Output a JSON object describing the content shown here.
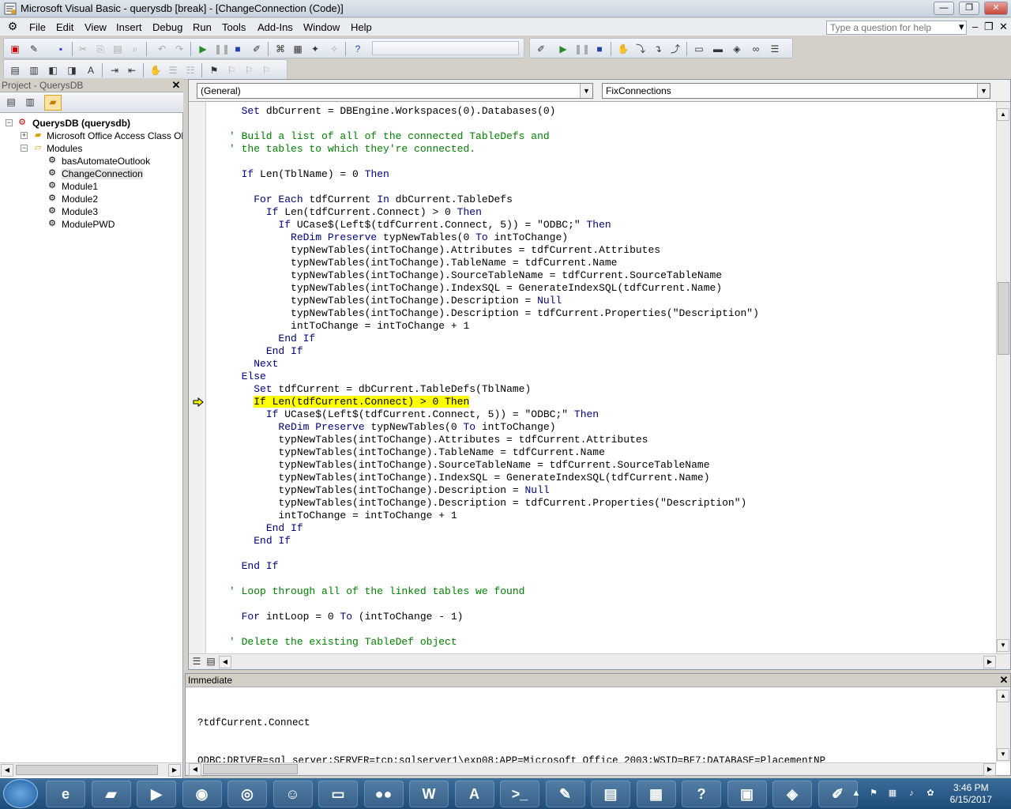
{
  "window": {
    "title": "Microsoft Visual Basic - querysdb [break] - [ChangeConnection (Code)]",
    "help_placeholder": "Type a question for help"
  },
  "menu": [
    "File",
    "Edit",
    "View",
    "Insert",
    "Debug",
    "Run",
    "Tools",
    "Add-Ins",
    "Window",
    "Help"
  ],
  "project": {
    "title": "Project - QuerysDB",
    "root": "QuerysDB (querysdb)",
    "folders": [
      "Microsoft Office Access Class Objects",
      "Modules"
    ],
    "modules": [
      "basAutomateOutlook",
      "ChangeConnection",
      "Module1",
      "Module2",
      "Module3",
      "ModulePWD"
    ],
    "selected_module": "ChangeConnection"
  },
  "code_window": {
    "object_combo": "(General)",
    "procedure_combo": "FixConnections",
    "current_line": 23,
    "lines": [
      [
        [
          "",
          "  "
        ],
        [
          "kw",
          "Set"
        ],
        [
          "",
          " dbCurrent = DBEngine.Workspaces(0).Databases(0)"
        ]
      ],
      [],
      [
        [
          "cm",
          "' Build a list of all of the connected TableDefs and"
        ]
      ],
      [
        [
          "cm",
          "' the tables to which they're connected."
        ]
      ],
      [],
      [
        [
          "",
          "  "
        ],
        [
          "kw",
          "If"
        ],
        [
          "",
          " Len(TblName) = 0 "
        ],
        [
          "kw",
          "Then"
        ]
      ],
      [],
      [
        [
          "",
          "    "
        ],
        [
          "kw",
          "For Each"
        ],
        [
          "",
          " tdfCurrent "
        ],
        [
          "kw",
          "In"
        ],
        [
          "",
          " dbCurrent.TableDefs"
        ]
      ],
      [
        [
          "",
          "      "
        ],
        [
          "kw",
          "If"
        ],
        [
          "",
          " Len(tdfCurrent.Connect) > 0 "
        ],
        [
          "kw",
          "Then"
        ]
      ],
      [
        [
          "",
          "        "
        ],
        [
          "kw",
          "If"
        ],
        [
          "",
          " UCase$(Left$(tdfCurrent.Connect, 5)) = \"ODBC;\" "
        ],
        [
          "kw",
          "Then"
        ]
      ],
      [
        [
          "",
          "          "
        ],
        [
          "kw",
          "ReDim Preserve"
        ],
        [
          "",
          " typNewTables(0 "
        ],
        [
          "kw",
          "To"
        ],
        [
          "",
          " intToChange)"
        ]
      ],
      [
        [
          "",
          "          typNewTables(intToChange).Attributes = tdfCurrent.Attributes"
        ]
      ],
      [
        [
          "",
          "          typNewTables(intToChange).TableName = tdfCurrent.Name"
        ]
      ],
      [
        [
          "",
          "          typNewTables(intToChange).SourceTableName = tdfCurrent.SourceTableName"
        ]
      ],
      [
        [
          "",
          "          typNewTables(intToChange).IndexSQL = GenerateIndexSQL(tdfCurrent.Name)"
        ]
      ],
      [
        [
          "",
          "          typNewTables(intToChange).Description = "
        ],
        [
          "kw",
          "Null"
        ]
      ],
      [
        [
          "",
          "          typNewTables(intToChange).Description = tdfCurrent.Properties(\"Description\")"
        ]
      ],
      [
        [
          "",
          "          intToChange = intToChange + 1"
        ]
      ],
      [
        [
          "",
          "        "
        ],
        [
          "kw",
          "End If"
        ]
      ],
      [
        [
          "",
          "      "
        ],
        [
          "kw",
          "End If"
        ]
      ],
      [
        [
          "",
          "    "
        ],
        [
          "kw",
          "Next"
        ]
      ],
      [
        [
          "",
          "  "
        ],
        [
          "kw",
          "Else"
        ]
      ],
      [
        [
          "",
          "    "
        ],
        [
          "kw",
          "Set"
        ],
        [
          "",
          " tdfCurrent = dbCurrent.TableDefs(TblName)"
        ]
      ],
      [
        [
          "",
          "    "
        ],
        [
          "hl",
          "If Len(tdfCurrent.Connect) > 0 Then"
        ]
      ],
      [
        [
          "",
          "      "
        ],
        [
          "kw",
          "If"
        ],
        [
          "",
          " UCase$(Left$(tdfCurrent.Connect, 5)) = \"ODBC;\" "
        ],
        [
          "kw",
          "Then"
        ]
      ],
      [
        [
          "",
          "        "
        ],
        [
          "kw",
          "ReDim Preserve"
        ],
        [
          "",
          " typNewTables(0 "
        ],
        [
          "kw",
          "To"
        ],
        [
          "",
          " intToChange)"
        ]
      ],
      [
        [
          "",
          "        typNewTables(intToChange).Attributes = tdfCurrent.Attributes"
        ]
      ],
      [
        [
          "",
          "        typNewTables(intToChange).TableName = tdfCurrent.Name"
        ]
      ],
      [
        [
          "",
          "        typNewTables(intToChange).SourceTableName = tdfCurrent.SourceTableName"
        ]
      ],
      [
        [
          "",
          "        typNewTables(intToChange).IndexSQL = GenerateIndexSQL(tdfCurrent.Name)"
        ]
      ],
      [
        [
          "",
          "        typNewTables(intToChange).Description = "
        ],
        [
          "kw",
          "Null"
        ]
      ],
      [
        [
          "",
          "        typNewTables(intToChange).Description = tdfCurrent.Properties(\"Description\")"
        ]
      ],
      [
        [
          "",
          "        intToChange = intToChange + 1"
        ]
      ],
      [
        [
          "",
          "      "
        ],
        [
          "kw",
          "End If"
        ]
      ],
      [
        [
          "",
          "    "
        ],
        [
          "kw",
          "End If"
        ]
      ],
      [],
      [
        [
          "",
          "  "
        ],
        [
          "kw",
          "End If"
        ]
      ],
      [],
      [
        [
          "cm",
          "' Loop through all of the linked tables we found"
        ]
      ],
      [],
      [
        [
          "",
          "  "
        ],
        [
          "kw",
          "For"
        ],
        [
          "",
          " intLoop = 0 "
        ],
        [
          "kw",
          "To"
        ],
        [
          "",
          " (intToChange - 1)"
        ]
      ],
      [],
      [
        [
          "cm",
          "' Delete the existing TableDef object"
        ]
      ]
    ]
  },
  "immediate": {
    "title": "Immediate",
    "lines": [
      "?tdfCurrent.Connect",
      "ODBC;DRIVER=sql server;SERVER=tcp:sqlserver1\\exp08;APP=Microsoft Office 2003;WSID=BF7;DATABASE=PlacementNP"
    ]
  },
  "taskbar": {
    "apps": [
      "internet-explorer",
      "file-explorer",
      "media-player",
      "chrome",
      "remote-desktop",
      "outlook-notes",
      "notepad",
      "flickr",
      "word",
      "acrobat",
      "command-prompt",
      "paint",
      "task-manager",
      "network",
      "help-viewer",
      "remote-connect",
      "utility",
      "access"
    ],
    "time": "3:46 PM",
    "date": "6/15/2017"
  },
  "colors": {
    "keyword": "#00007f",
    "comment": "#007f00",
    "highlight": "#ffff00"
  }
}
